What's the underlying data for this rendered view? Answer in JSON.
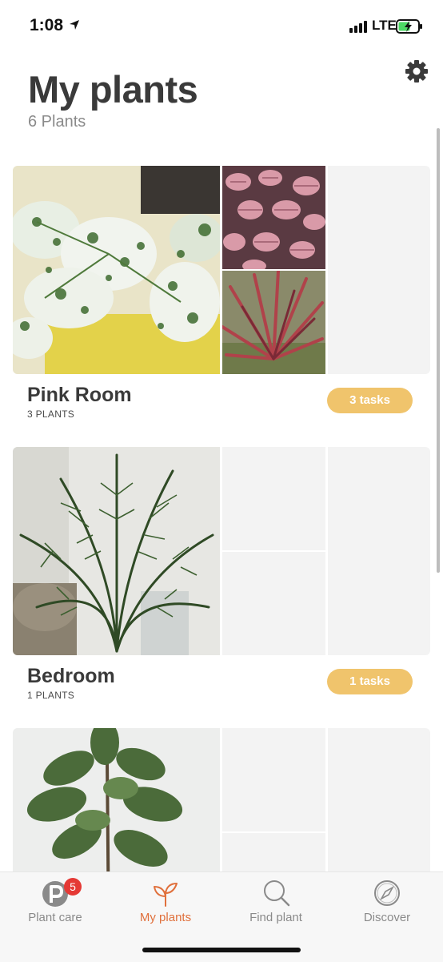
{
  "status_bar": {
    "time": "1:08",
    "network": "LTE"
  },
  "header": {
    "title": "My plants",
    "subtitle": "6 Plants",
    "settings_icon": "gear-icon"
  },
  "rooms": [
    {
      "name": "Pink Room",
      "count": "3 PLANTS",
      "tasks": "3 tasks",
      "photos": [
        "white-green-caladium",
        "pink-fittonia",
        "red-cordyline"
      ]
    },
    {
      "name": "Bedroom",
      "count": "1 PLANTS",
      "tasks": "1 tasks",
      "photos": [
        "areca-palm"
      ]
    },
    {
      "photos": [
        "fiddle-leaf-fig"
      ]
    }
  ],
  "tabbar": {
    "tabs": [
      {
        "label": "Plant care",
        "icon": "plant-care-p-icon",
        "badge": "5"
      },
      {
        "label": "My plants",
        "icon": "sprout-icon",
        "active": true
      },
      {
        "label": "Find plant",
        "icon": "search-icon"
      },
      {
        "label": "Discover",
        "icon": "compass-icon"
      }
    ]
  },
  "colors": {
    "accent": "#e0703c",
    "tasks_pill": "#f0c46c",
    "badge": "#e53935"
  }
}
